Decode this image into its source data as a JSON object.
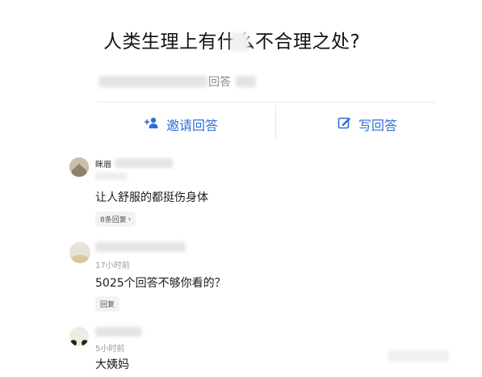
{
  "question": {
    "title": "人类生理上有什么不合理之处?",
    "answers_count_label": "回答"
  },
  "actions": {
    "invite_label": "邀请回答",
    "write_label": "写回答",
    "accent_color": "#2f6fd6"
  },
  "comments": [
    {
      "username": "眯眉",
      "time": "",
      "text": "让人舒服的都挺伤身体",
      "reply_label": "8条回复",
      "reply_chevron": "›"
    },
    {
      "username": "",
      "time": "17小时前",
      "text": "5025个回答不够你看的？",
      "reply_label": "回复"
    },
    {
      "username": "",
      "time": "5小时前",
      "text": "大姨妈"
    }
  ]
}
